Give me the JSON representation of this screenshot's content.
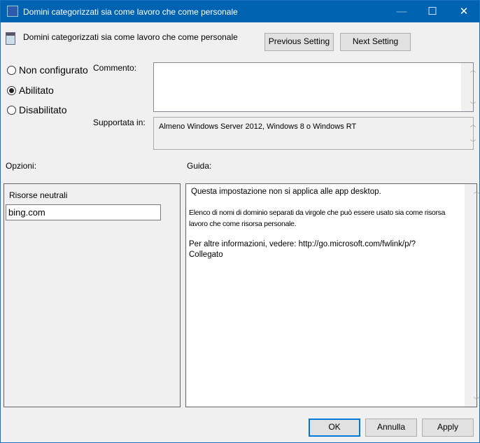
{
  "window": {
    "title": "Domini categorizzati sia come lavoro che come personale",
    "controls": {
      "minimize": "—",
      "maximize": "☐",
      "close": "✕"
    }
  },
  "header": {
    "setting_name": "Domini categorizzati sia come lavoro che come personale",
    "previous_label": "Previous Setting",
    "next_label": "Next Setting"
  },
  "state": {
    "options": [
      {
        "label": "Non configurato",
        "selected": false
      },
      {
        "label": "Abilitato",
        "selected": true
      },
      {
        "label": "Disabilitato",
        "selected": false
      }
    ]
  },
  "comment": {
    "label": "Commento:",
    "value": ""
  },
  "supported": {
    "label": "Supportata in:",
    "value": "Almeno Windows Server 2012, Windows 8 o Windows RT"
  },
  "options_panel": {
    "label": "Opzioni:",
    "field_label": "Risorse neutrali",
    "field_value": "bing.com"
  },
  "help_panel": {
    "label": "Guida:",
    "lines": [
      "Questa impostazione non si applica alle app desktop.",
      "Elenco di nomi di dominio separati da virgole che può essere usato sia come risorsa lavoro che come risorsa personale.",
      "Per altre informazioni, vedere: http://go.microsoft.com/fwlink/p/?",
      "Collegato"
    ]
  },
  "footer": {
    "ok": "OK",
    "cancel": "Annulla",
    "apply": "Apply"
  },
  "colors": {
    "titlebar": "#0063b1",
    "background": "#f0f0f0"
  }
}
